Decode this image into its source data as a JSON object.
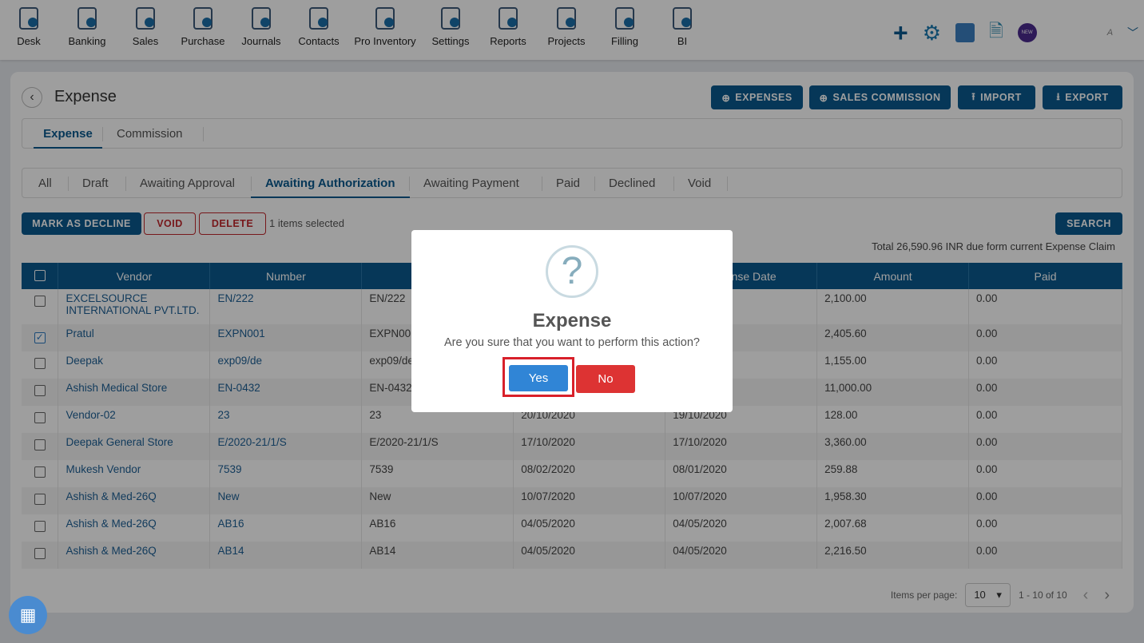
{
  "nav": [
    {
      "label": "Desk",
      "icon": "desk-icon"
    },
    {
      "label": "Banking",
      "icon": "bank-icon"
    },
    {
      "label": "Sales",
      "icon": "sales-icon"
    },
    {
      "label": "Purchase",
      "icon": "purchase-icon"
    },
    {
      "label": "Journals",
      "icon": "journals-icon"
    },
    {
      "label": "Contacts",
      "icon": "contacts-icon"
    },
    {
      "label": "Pro Inventory",
      "icon": "inventory-icon"
    },
    {
      "label": "Settings",
      "icon": "settings-icon"
    },
    {
      "label": "Reports",
      "icon": "reports-icon"
    },
    {
      "label": "Projects",
      "icon": "projects-icon"
    },
    {
      "label": "Filling",
      "icon": "filling-icon"
    },
    {
      "label": "BI",
      "icon": "bi-icon"
    }
  ],
  "header": {
    "user_initial": "A",
    "new_badge": "NEW"
  },
  "page": {
    "title": "Expense",
    "buttons": {
      "expenses": "EXPENSES",
      "sales_commission": "SALES COMMISSION",
      "import": "IMPORT",
      "export": "EXPORT"
    }
  },
  "tabs": [
    "Expense",
    "Commission"
  ],
  "status_tabs": [
    "All",
    "Draft",
    "Awaiting Approval",
    "Awaiting Authorization",
    "Awaiting Payment",
    "Paid",
    "Declined",
    "Void"
  ],
  "actions": {
    "mark_decline": "MARK AS DECLINE",
    "void": "VOID",
    "delete": "DELETE",
    "selected": "1 items selected",
    "search": "SEARCH"
  },
  "total": "Total 26,590.96 INR due form current Expense Claim",
  "table": {
    "columns": [
      "Vendor",
      "Number",
      "",
      "",
      "Expense Date",
      "Amount",
      "Paid"
    ],
    "rows": [
      {
        "checked": false,
        "c": [
          "EXCELSOURCE INTERNATIONAL PVT.LTD.",
          "EN/222",
          "EN/222",
          "",
          "",
          "2,100.00",
          "0.00"
        ]
      },
      {
        "checked": true,
        "c": [
          "Pratul",
          "EXPN001",
          "EXPN001",
          "",
          "",
          "2,405.60",
          "0.00"
        ]
      },
      {
        "checked": false,
        "c": [
          "Deepak",
          "exp09/de",
          "exp09/de",
          "",
          "",
          "1,155.00",
          "0.00"
        ]
      },
      {
        "checked": false,
        "c": [
          "Ashish Medical Store",
          "EN-0432",
          "EN-0432",
          "",
          "",
          "11,000.00",
          "0.00"
        ]
      },
      {
        "checked": false,
        "c": [
          "Vendor-02",
          "23",
          "23",
          "20/10/2020",
          "19/10/2020",
          "128.00",
          "0.00"
        ]
      },
      {
        "checked": false,
        "c": [
          "Deepak General Store",
          "E/2020-21/1/S",
          "E/2020-21/1/S",
          "17/10/2020",
          "17/10/2020",
          "3,360.00",
          "0.00"
        ]
      },
      {
        "checked": false,
        "c": [
          "Mukesh Vendor",
          "7539",
          "7539",
          "08/02/2020",
          "08/01/2020",
          "259.88",
          "0.00"
        ]
      },
      {
        "checked": false,
        "c": [
          "Ashish & Med-26Q",
          "New",
          "New",
          "10/07/2020",
          "10/07/2020",
          "1,958.30",
          "0.00"
        ]
      },
      {
        "checked": false,
        "c": [
          "Ashish & Med-26Q",
          "AB16",
          "AB16",
          "04/05/2020",
          "04/05/2020",
          "2,007.68",
          "0.00"
        ]
      },
      {
        "checked": false,
        "c": [
          "Ashish & Med-26Q",
          "AB14",
          "AB14",
          "04/05/2020",
          "04/05/2020",
          "2,216.50",
          "0.00"
        ]
      }
    ]
  },
  "pagination": {
    "label": "Items per page:",
    "per_page": "10",
    "range": "1 - 10 of 10"
  },
  "modal": {
    "icon": "?",
    "title": "Expense",
    "message": "Are you sure that you want to perform this action?",
    "yes": "Yes",
    "no": "No"
  },
  "colors": {
    "primary": "#0b5a8f",
    "yes": "#3085d6",
    "no": "#dd3333",
    "highlight": "#d8202a"
  }
}
